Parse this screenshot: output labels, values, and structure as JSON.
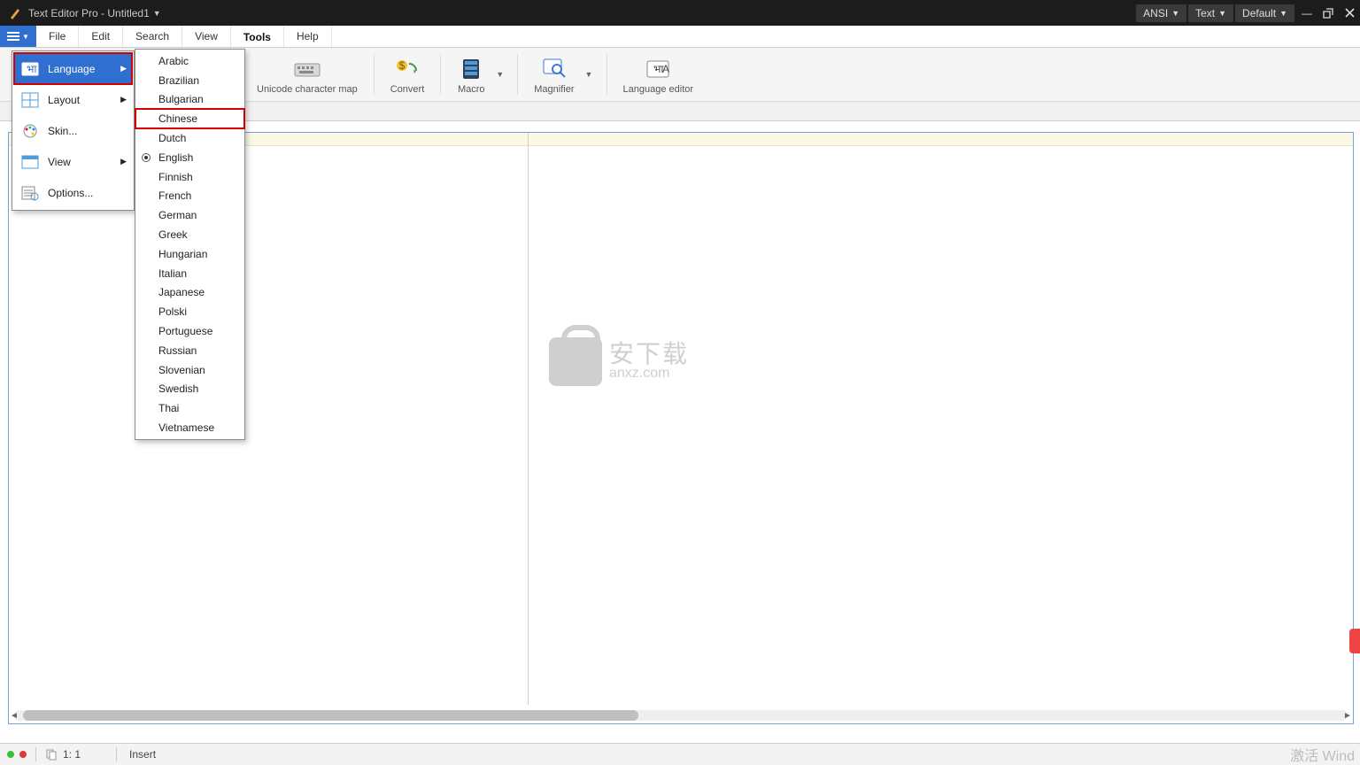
{
  "titlebar": {
    "app_name": "Text Editor Pro",
    "separator": "  -  ",
    "doc_name": "Untitled1",
    "enc_buttons": [
      "ANSI",
      "Text",
      "Default"
    ]
  },
  "menubar": {
    "items": [
      "File",
      "Edit",
      "Search",
      "View",
      "Tools",
      "Help"
    ],
    "active_index": 4
  },
  "ribbon": {
    "items": [
      {
        "label": "Unicode character map"
      },
      {
        "label": "Convert"
      },
      {
        "label": "Macro"
      },
      {
        "label": "Magnifier"
      },
      {
        "label": "Language editor"
      }
    ]
  },
  "tools_menu": {
    "items": [
      {
        "label": "Language",
        "has_sub": true,
        "selected": true,
        "boxed": true
      },
      {
        "label": "Layout",
        "has_sub": true
      },
      {
        "label": "Skin..."
      },
      {
        "label": "View",
        "has_sub": true
      },
      {
        "label": "Options..."
      }
    ]
  },
  "language_menu": {
    "items": [
      "Arabic",
      "Brazilian",
      "Bulgarian",
      "Chinese",
      "Dutch",
      "English",
      "Finnish",
      "French",
      "German",
      "Greek",
      "Hungarian",
      "Italian",
      "Japanese",
      "Polski",
      "Portuguese",
      "Russian",
      "Slovenian",
      "Swedish",
      "Thai",
      "Vietnamese"
    ],
    "boxed_index": 3,
    "radio_index": 5
  },
  "watermark": {
    "cn": "安下载",
    "en": "anxz.com"
  },
  "statusbar": {
    "pos": "1: 1",
    "mode": "Insert",
    "activate": "激活 Wind"
  }
}
